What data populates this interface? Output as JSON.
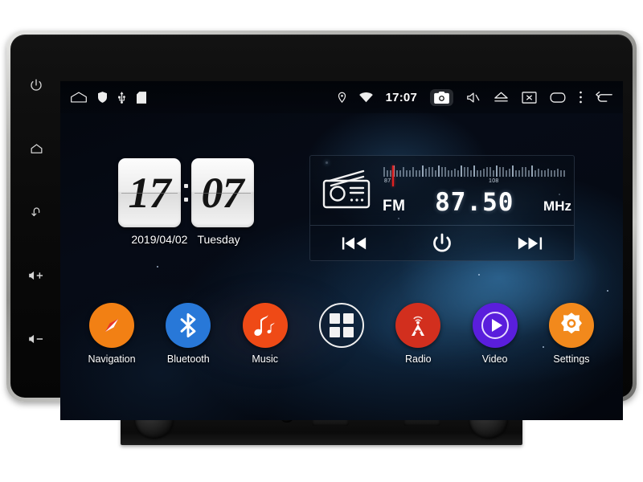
{
  "device": {
    "type": "android-car-head-unit",
    "bezel_color": "#b9b9b6",
    "frame_color": "#0a0a0a"
  },
  "hard_keys": [
    {
      "name": "power-key",
      "icon": "power-icon"
    },
    {
      "name": "home-key",
      "icon": "home-icon"
    },
    {
      "name": "back-key",
      "icon": "back-arrow-icon"
    },
    {
      "name": "volume-up-key",
      "icon": "volume-up-icon"
    },
    {
      "name": "volume-down-key",
      "icon": "volume-down-icon"
    }
  ],
  "status_bar": {
    "clock": "17:07",
    "left_icons": [
      {
        "name": "home-icon",
        "label": "Home"
      },
      {
        "name": "shield-icon",
        "label": "Shield"
      },
      {
        "name": "usb-icon",
        "label": "USB"
      },
      {
        "name": "sdcard-icon",
        "label": "SD Card"
      }
    ],
    "right_icons": [
      {
        "name": "location-pin-icon",
        "label": "GPS"
      },
      {
        "name": "wifi-icon",
        "label": "Wi-Fi"
      },
      {
        "name": "camera-icon",
        "label": "Camera"
      },
      {
        "name": "mute-icon",
        "label": "Mute"
      },
      {
        "name": "eject-icon",
        "label": "Eject"
      },
      {
        "name": "screen-off-icon",
        "label": "Screen Off"
      },
      {
        "name": "recents-icon",
        "label": "Recent Apps"
      },
      {
        "name": "overflow-menu-icon",
        "label": "More"
      },
      {
        "name": "back-arrow-icon",
        "label": "Back"
      }
    ],
    "camera_highlighted": true
  },
  "clock_widget": {
    "hours": "17",
    "minutes": "07",
    "date": "2019/04/02",
    "weekday": "Tuesday"
  },
  "radio_widget": {
    "band": "FM",
    "frequency": "87.50",
    "unit": "MHz",
    "scale_min": "87",
    "scale_max": "108",
    "controls": [
      {
        "name": "prev-station-button",
        "icon": "skip-previous-icon"
      },
      {
        "name": "radio-power-button",
        "icon": "power-icon"
      },
      {
        "name": "next-station-button",
        "icon": "skip-next-icon"
      }
    ]
  },
  "apps": [
    {
      "name": "navigation",
      "label": "Navigation",
      "icon": "compass-icon",
      "color": "#f28014",
      "hollow": false
    },
    {
      "name": "bluetooth",
      "label": "Bluetooth",
      "icon": "bluetooth-icon",
      "color": "#2878d8",
      "hollow": false
    },
    {
      "name": "music",
      "label": "Music",
      "icon": "music-note-icon",
      "color": "#ef4a16",
      "hollow": false
    },
    {
      "name": "app-drawer",
      "label": "",
      "icon": "apps-grid-icon",
      "color": "transparent",
      "hollow": true
    },
    {
      "name": "radio",
      "label": "Radio",
      "icon": "radio-tower-icon",
      "color": "#d22f1e",
      "hollow": false
    },
    {
      "name": "video",
      "label": "Video",
      "icon": "play-circle-icon",
      "color": "#5a1edc",
      "hollow": false
    },
    {
      "name": "settings",
      "label": "Settings",
      "icon": "gear-icon",
      "color": "#f2891c",
      "hollow": false
    }
  ]
}
